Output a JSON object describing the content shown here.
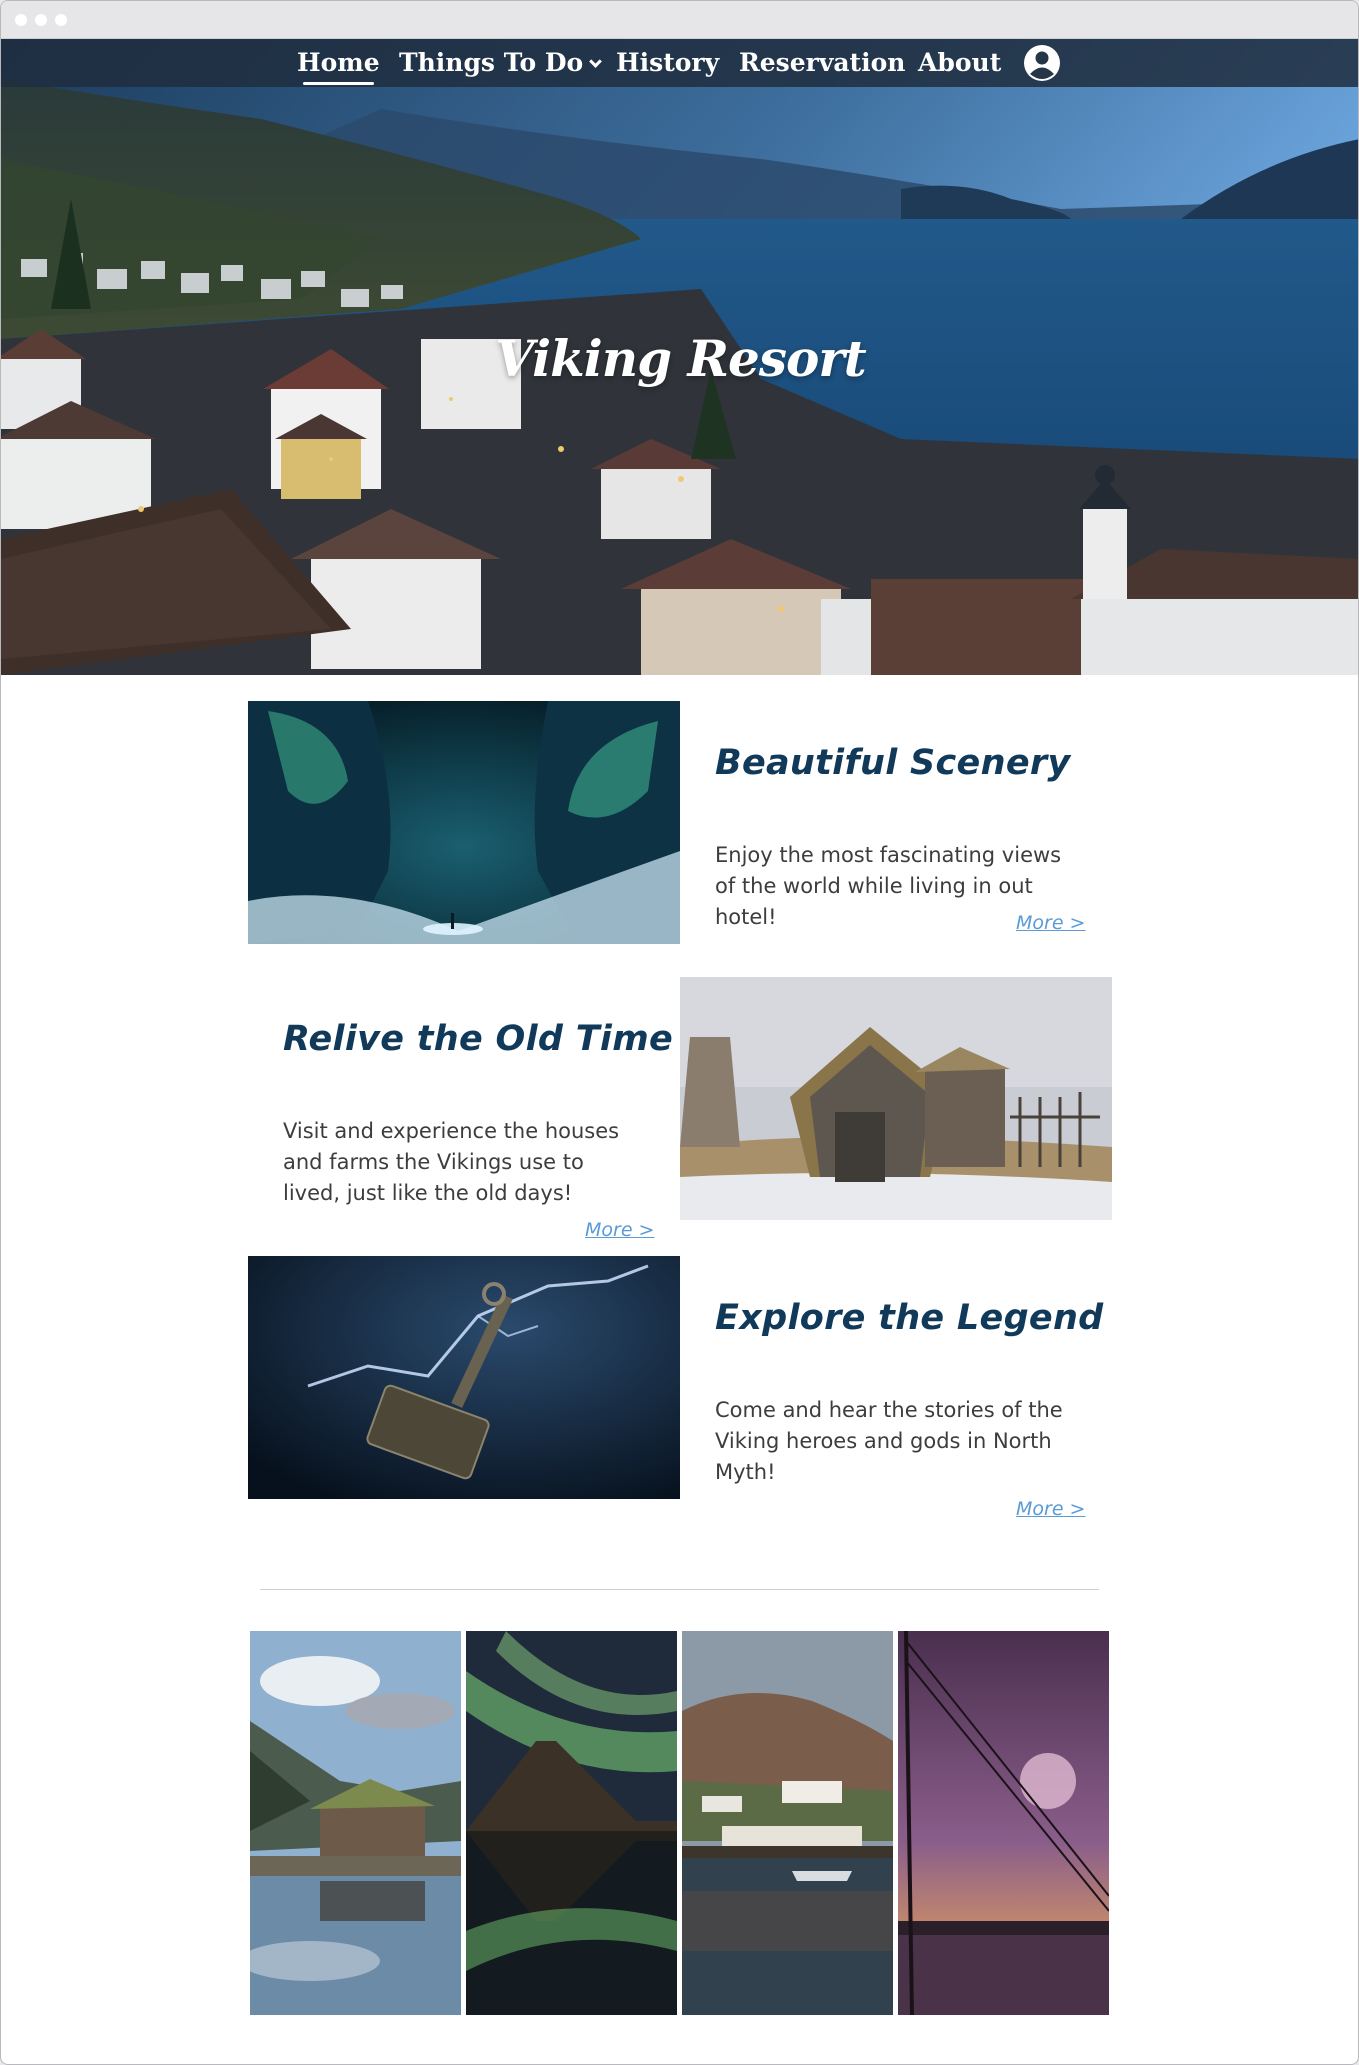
{
  "nav": {
    "items": [
      {
        "label": "Home",
        "active": true
      },
      {
        "label": "Things To Do",
        "dropdown": true
      },
      {
        "label": "History"
      },
      {
        "label": "Reservation"
      },
      {
        "label": "About"
      }
    ],
    "account_icon": "account-circle-icon"
  },
  "hero": {
    "title": "Viking Resort",
    "image": "lakeside-village-photo"
  },
  "features": [
    {
      "title": "Beautiful Scenery",
      "text": "Enjoy the most fascinating views of the world while living in out hotel!",
      "more": "More >",
      "image": "ice-cave-photo"
    },
    {
      "title": "Relive the Old Time",
      "text": "Visit and experience the houses and farms the Vikings use to lived, just like the old days!",
      "more": "More >",
      "image": "viking-turf-house-photo"
    },
    {
      "title": "Explore the Legend",
      "text": "Come and hear the stories of the Viking heroes and gods in North Myth!",
      "more": "More >",
      "image": "thor-hammer-photo"
    }
  ],
  "gallery": [
    {
      "image": "boathouse-lake-photo"
    },
    {
      "image": "aurora-mountain-photo"
    },
    {
      "image": "harbor-village-photo"
    },
    {
      "image": "purple-sunset-mast-photo"
    }
  ],
  "colors": {
    "nav_bg": "#202d3f",
    "title": "#10395a",
    "link": "#5b9bd5",
    "text": "#3d3d3d"
  }
}
